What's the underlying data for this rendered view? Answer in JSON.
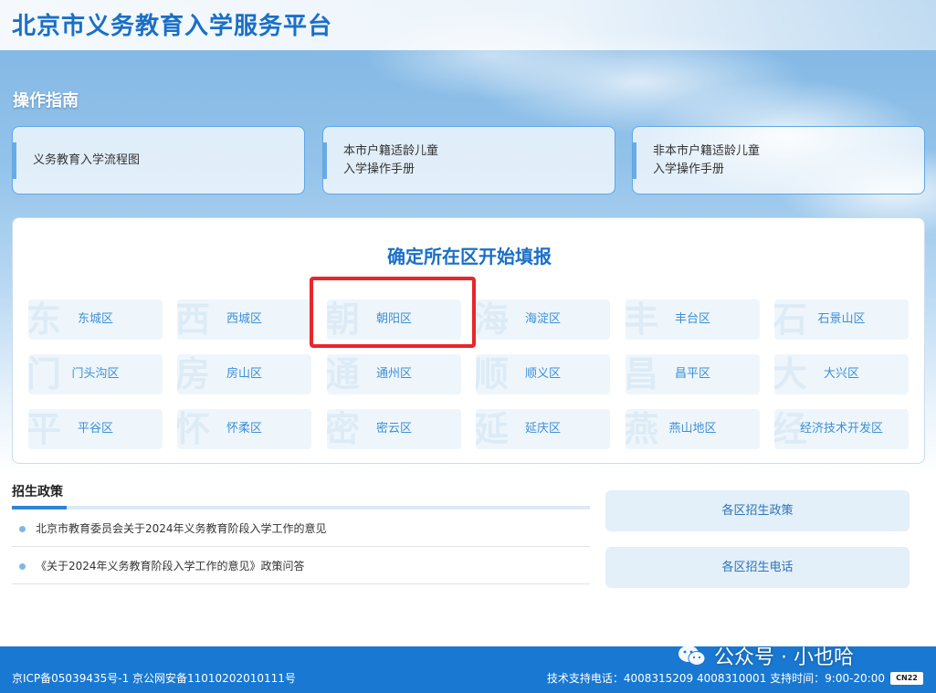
{
  "header": {
    "title": "北京市义务教育入学服务平台"
  },
  "guide": {
    "title": "操作指南",
    "cards": [
      {
        "label": "义务教育入学流程图"
      },
      {
        "label": "本市户籍适龄儿童\n入学操作手册"
      },
      {
        "label": "非本市户籍适龄儿童\n入学操作手册"
      }
    ]
  },
  "districts": {
    "heading": "确定所在区开始填报",
    "items": [
      {
        "label": "东城区",
        "wm": "东"
      },
      {
        "label": "西城区",
        "wm": "西"
      },
      {
        "label": "朝阳区",
        "wm": "朝"
      },
      {
        "label": "海淀区",
        "wm": "海"
      },
      {
        "label": "丰台区",
        "wm": "丰"
      },
      {
        "label": "石景山区",
        "wm": "石"
      },
      {
        "label": "门头沟区",
        "wm": "门"
      },
      {
        "label": "房山区",
        "wm": "房"
      },
      {
        "label": "通州区",
        "wm": "通"
      },
      {
        "label": "顺义区",
        "wm": "顺"
      },
      {
        "label": "昌平区",
        "wm": "昌"
      },
      {
        "label": "大兴区",
        "wm": "大"
      },
      {
        "label": "平谷区",
        "wm": "平"
      },
      {
        "label": "怀柔区",
        "wm": "怀"
      },
      {
        "label": "密云区",
        "wm": "密"
      },
      {
        "label": "延庆区",
        "wm": "延"
      },
      {
        "label": "燕山地区",
        "wm": "燕"
      },
      {
        "label": "经济技术开发区",
        "wm": "经"
      }
    ],
    "highlighted": "朝阳区",
    "highlight_color": "#e8262b"
  },
  "policy": {
    "title": "招生政策",
    "items": [
      {
        "text": "北京市教育委员会关于2024年义务教育阶段入学工作的意见"
      },
      {
        "text": "《关于2024年义务教育阶段入学工作的意见》政策问答"
      }
    ]
  },
  "side_buttons": [
    {
      "label": "各区招生政策"
    },
    {
      "label": "各区招生电话"
    }
  ],
  "footer": {
    "left": "京ICP备05039435号-1 京公网安备11010202010111号",
    "right": "技术支持电话：4008315209 4008310001 支持时间：9:00-20:00",
    "badge": "CN22"
  },
  "watermark": {
    "text": "公众号 · 小也哈",
    "icon": "wechat-icon"
  },
  "colors": {
    "brand": "#1a6fc7",
    "footer_bg": "#1878d2",
    "district_text": "#3d8fd6"
  }
}
